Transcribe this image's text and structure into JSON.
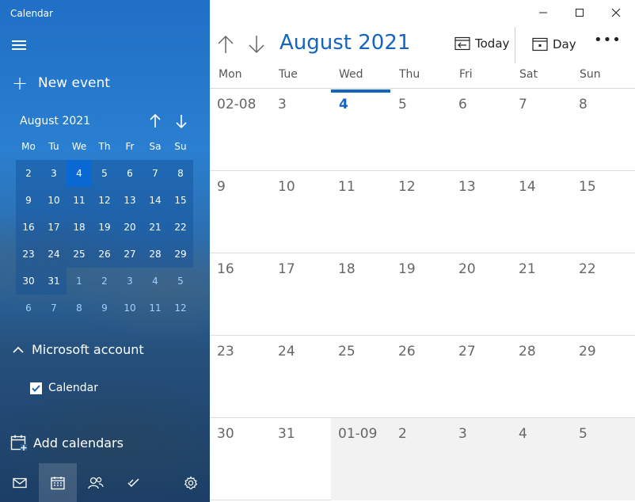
{
  "app": {
    "title": "Calendar"
  },
  "sidebar": {
    "new_event_label": "New event",
    "mini": {
      "month_label": "August 2021",
      "dow": [
        "Mo",
        "Tu",
        "We",
        "Th",
        "Fr",
        "Sa",
        "Su"
      ],
      "weeks": [
        [
          "2",
          "3",
          "4",
          "5",
          "6",
          "7",
          "8"
        ],
        [
          "9",
          "10",
          "11",
          "12",
          "13",
          "14",
          "15"
        ],
        [
          "16",
          "17",
          "18",
          "19",
          "20",
          "21",
          "22"
        ],
        [
          "23",
          "24",
          "25",
          "26",
          "27",
          "28",
          "29"
        ],
        [
          "30",
          "31",
          "1",
          "2",
          "3",
          "4",
          "5"
        ],
        [
          "6",
          "7",
          "8",
          "9",
          "10",
          "11",
          "12"
        ]
      ]
    },
    "account_label": "Microsoft account",
    "calendar_item_label": "Calendar",
    "add_calendars_label": "Add calendars"
  },
  "main": {
    "title": "August 2021",
    "today_label": "Today",
    "day_label": "Day",
    "more_label": "•••",
    "dow": [
      "Mon",
      "Tue",
      "Wed",
      "Thu",
      "Fri",
      "Sat",
      "Sun"
    ],
    "weeks": [
      [
        "02-08",
        "3",
        "4",
        "5",
        "6",
        "7",
        "8"
      ],
      [
        "9",
        "10",
        "11",
        "12",
        "13",
        "14",
        "15"
      ],
      [
        "16",
        "17",
        "18",
        "19",
        "20",
        "21",
        "22"
      ],
      [
        "23",
        "24",
        "25",
        "26",
        "27",
        "28",
        "29"
      ],
      [
        "30",
        "31",
        "01-09",
        "2",
        "3",
        "4",
        "5"
      ]
    ]
  },
  "colors": {
    "accent": "#1565c0",
    "sidebar_blue": "#2b7fd0",
    "today_fill": "#0a68d2"
  }
}
